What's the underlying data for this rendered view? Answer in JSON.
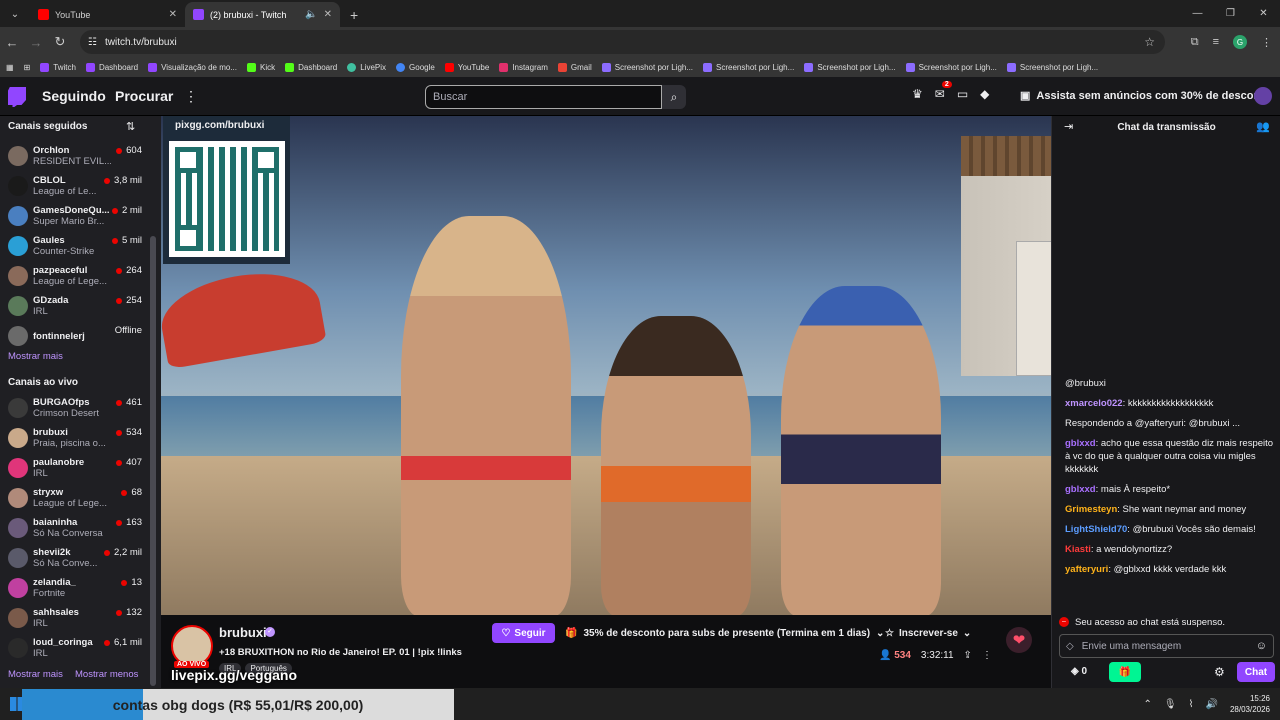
{
  "browser": {
    "tabs": [
      {
        "title": "YouTube",
        "color": "#ff0000",
        "active": false
      },
      {
        "title": "(2) brubuxi - Twitch",
        "color": "#9146ff",
        "active": true
      }
    ],
    "url": "twitch.tv/brubuxi",
    "bookmarks": [
      {
        "label": "Twitch",
        "color": "#9146ff"
      },
      {
        "label": "Dashboard",
        "color": "#9146ff"
      },
      {
        "label": "Visualização de mo...",
        "color": "#9146ff"
      },
      {
        "label": "Kick",
        "color": "#53fc18"
      },
      {
        "label": "Dashboard",
        "color": "#53fc18"
      },
      {
        "label": "LivePix",
        "color": "#40c0a0"
      },
      {
        "label": "Google",
        "color": "#4285f4"
      },
      {
        "label": "YouTube",
        "color": "#ff0000"
      },
      {
        "label": "Instagram",
        "color": "#e1306c"
      },
      {
        "label": "Gmail",
        "color": "#ea4335"
      },
      {
        "label": "Screenshot por Ligh...",
        "color": "#8c6cff"
      },
      {
        "label": "Screenshot por Ligh...",
        "color": "#8c6cff"
      },
      {
        "label": "Screenshot por Ligh...",
        "color": "#8c6cff"
      },
      {
        "label": "Screenshot por Ligh...",
        "color": "#8c6cff"
      },
      {
        "label": "Screenshot por Ligh...",
        "color": "#8c6cff"
      }
    ],
    "profile_initial": "G"
  },
  "header": {
    "following": "Seguindo",
    "browse": "Procurar",
    "search_placeholder": "Buscar",
    "notif_count": "2",
    "promo": "Assista sem anúncios com 30% de desconto"
  },
  "sidebar": {
    "followed_title": "Canais seguidos",
    "followed": [
      {
        "name": "Orchlon",
        "game": "RESIDENT EVIL...",
        "viewers": "604",
        "color": "#7a6a60"
      },
      {
        "name": "CBLOL",
        "game": "League of Le...",
        "viewers": "3,8 mil",
        "color": "#1a1a1a"
      },
      {
        "name": "GamesDoneQu...",
        "game": "Super Mario Br...",
        "viewers": "2 mil",
        "color": "#4a7fc0"
      },
      {
        "name": "Gaules",
        "game": "Counter-Strike",
        "viewers": "5 mil",
        "color": "#2a9fd6"
      },
      {
        "name": "pazpeaceful",
        "game": "League of Lege...",
        "viewers": "264",
        "color": "#8a6a5a"
      },
      {
        "name": "GDzada",
        "game": "IRL",
        "viewers": "254",
        "color": "#5a7a5a"
      },
      {
        "name": "fontinnelerj",
        "game": "",
        "viewers": "Offline",
        "color": "#6a6a6a"
      }
    ],
    "show_more": "Mostrar mais",
    "live_title": "Canais ao vivo",
    "live": [
      {
        "name": "BURGAOfps",
        "game": "Crimson Desert",
        "viewers": "461",
        "color": "#3a3a3a"
      },
      {
        "name": "brubuxi",
        "game": "Praia, piscina o...",
        "viewers": "534",
        "color": "#c9a98a"
      },
      {
        "name": "paulanobre",
        "game": "IRL",
        "viewers": "407",
        "color": "#e0357a"
      },
      {
        "name": "stryxw",
        "game": "League of Lege...",
        "viewers": "68",
        "color": "#b08a7a"
      },
      {
        "name": "baianinha",
        "game": "Só Na Conversa",
        "viewers": "163",
        "color": "#6a5a7a"
      },
      {
        "name": "shevii2k",
        "game": "Só Na Conve...",
        "viewers": "2,2 mil",
        "color": "#5a5a6a"
      },
      {
        "name": "zelandia_",
        "game": "Fortnite",
        "viewers": "13",
        "color": "#c040a0"
      },
      {
        "name": "sahhsales",
        "game": "IRL",
        "viewers": "132",
        "color": "#7a5a4a"
      },
      {
        "name": "loud_coringa",
        "game": "IRL",
        "viewers": "6,1 mil",
        "color": "#2a2a2a"
      }
    ],
    "show_more2": "Mostrar mais",
    "show_less": "Mostrar menos"
  },
  "video": {
    "qr_label": "pixgg.com/brubuxi"
  },
  "stream": {
    "channel": "brubuxi",
    "live_badge": "AO VIVO",
    "title": "+18 BRUXITHON no Rio de Janeiro! EP. 01 | !pix !links",
    "tags": [
      "IRL",
      "Português"
    ],
    "overlay": "livepix.gg/veggano",
    "follow": "Seguir",
    "gift_promo": "35% de desconto para subs de presente (Termina em 1 dias)",
    "subscribe": "Inscrever-se",
    "viewers": "534",
    "uptime": "3:32:11"
  },
  "chat": {
    "title": "Chat da transmissão",
    "messages": [
      {
        "user": "",
        "text": "@brubuxi",
        "color": "#efeff1"
      },
      {
        "user": "xmarcelo022",
        "text": ": kkkkkkkkkkkkkkkkkk",
        "color": "#bf94ff"
      },
      {
        "user": "",
        "text": "Respondendo a @yafteryuri: @brubuxi ...",
        "color": "#efeff1"
      },
      {
        "user": "gblxxd",
        "text": ": acho que essa questão diz mais respeito à vc do que à qualquer outra coisa viu migles kkkkkkk",
        "color": "#a970ff"
      },
      {
        "user": "gblxxd",
        "text": ": mais À respeito*",
        "color": "#a970ff"
      },
      {
        "user": "Grimesteyn",
        "text": ": She want neymar and money",
        "color": "#ffb31a"
      },
      {
        "user": "LightShield70",
        "text": ": @brubuxi Vocês são demais!",
        "color": "#5c9dff"
      },
      {
        "user": "Kiasti",
        "text": ": a wendolynortizz?",
        "color": "#ff3b3b"
      },
      {
        "user": "yafteryuri",
        "text": ": @gblxxd kkkk verdade kkk",
        "color": "#ffb31a"
      }
    ],
    "suspended": "Seu acesso ao chat está suspenso.",
    "input_placeholder": "Envie uma mensagem",
    "points": "0",
    "chat_button": "Chat"
  },
  "taskbar": {
    "banner": "contas obg dogs (R$ 55,01/R$ 200,00)",
    "time": "15:26",
    "date": "28/03/2026"
  }
}
